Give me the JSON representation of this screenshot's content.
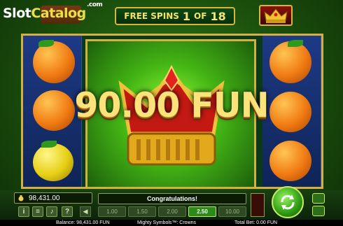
{
  "header": {
    "logo": {
      "prefix": "Slot",
      "middle": "Catalog",
      "suffix": ".com"
    },
    "free_spins": {
      "label": "FREE SPINS",
      "current": "1",
      "of": "OF",
      "total": "18"
    }
  },
  "win": {
    "amount": "90.00 FUN"
  },
  "panel": {
    "balance": "98,431.00",
    "message": "Congratulations!",
    "bets": [
      "1.00",
      "1.50",
      "2.00",
      "2.50",
      "10.00"
    ],
    "active_bet": "2.50"
  },
  "status": {
    "balance": "Balance: 98,431.00 FUN",
    "game": "Mighty Symbols™: Crowns",
    "total_bet": "Total Bet: 0.00 FUN"
  },
  "colors": {
    "gold": "#d3b043",
    "accent_green": "#2b8b19",
    "win_text": "#fbe27a"
  },
  "icons": [
    "bag-icon",
    "info-icon",
    "menu-icon",
    "sound-icon",
    "help-icon",
    "spin-icon",
    "autoplay-icon",
    "play-icon",
    "crown-icon"
  ]
}
